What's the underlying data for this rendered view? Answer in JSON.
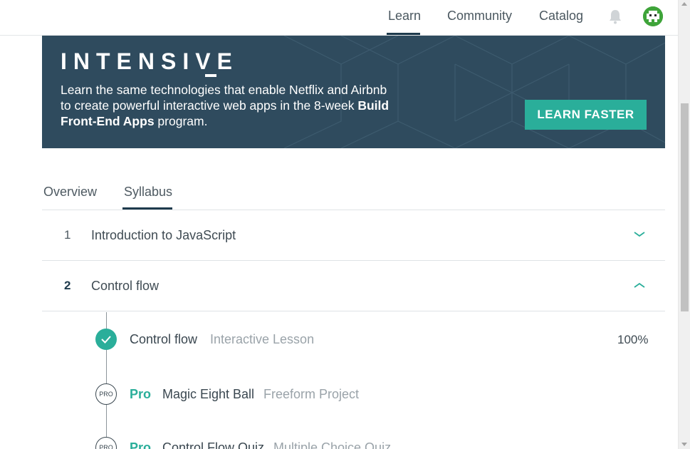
{
  "nav": {
    "items": [
      {
        "label": "Learn",
        "active": true
      },
      {
        "label": "Community",
        "active": false
      },
      {
        "label": "Catalog",
        "active": false
      }
    ],
    "notification_icon": "bell-icon",
    "avatar_icon": "avatar"
  },
  "banner": {
    "heading": "INTENSIVE",
    "text_part1": "Learn the same technologies that enable Netflix and Airbnb to create powerful interactive web apps in the 8-week ",
    "text_bold": "Build Front-End Apps",
    "text_part2": " program.",
    "cta_label": "LEARN FASTER",
    "cta_color": "#2aae9a",
    "background_color": "#2f4b5e"
  },
  "tabs": [
    {
      "label": "Overview",
      "active": false
    },
    {
      "label": "Syllabus",
      "active": true
    }
  ],
  "syllabus": {
    "sections": [
      {
        "number": "1",
        "title": "Introduction to JavaScript",
        "expanded": false,
        "chevron_icon": "chevron-down-icon"
      },
      {
        "number": "2",
        "title": "Control flow",
        "expanded": true,
        "chevron_icon": "chevron-up-icon"
      }
    ],
    "lessons": [
      {
        "title": "Control flow",
        "type": "Interactive Lesson",
        "status": "complete",
        "progress": "100%",
        "pro": false
      },
      {
        "title": "Magic Eight Ball",
        "type": "Freeform Project",
        "status": "pro",
        "pro_label": "Pro",
        "badge": "PRO",
        "pro": true
      },
      {
        "title": "Control Flow Quiz",
        "type": "Multiple Choice Quiz",
        "status": "pro",
        "pro_label": "Pro",
        "badge": "PRO",
        "pro": true
      }
    ]
  },
  "colors": {
    "accent": "#2aae9a",
    "nav_underline": "#1e3a4c",
    "text": "#3a4750",
    "muted_text": "#9aa3a9"
  }
}
